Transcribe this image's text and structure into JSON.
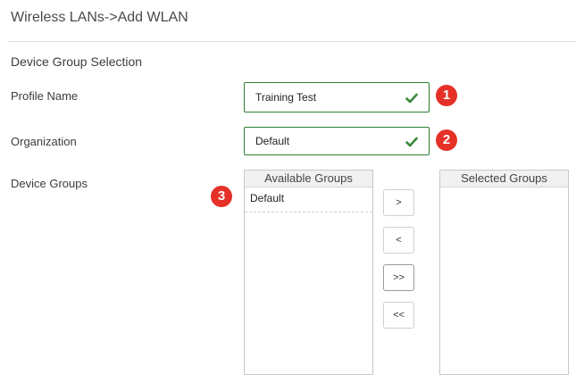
{
  "page": {
    "title": "Wireless LANs->Add WLAN"
  },
  "section": {
    "title": "Device Group Selection"
  },
  "fields": {
    "profile_name": {
      "label": "Profile Name",
      "value": "Training Test",
      "marker": "1",
      "valid_icon": "check-icon"
    },
    "organization": {
      "label": "Organization",
      "value": "Default",
      "marker": "2",
      "valid_icon": "check-icon"
    }
  },
  "device_groups": {
    "label": "Device Groups",
    "marker": "3",
    "available": {
      "header": "Available Groups",
      "items": [
        "Default"
      ]
    },
    "selected": {
      "header": "Selected Groups",
      "items": []
    },
    "buttons": {
      "add": ">",
      "remove": "<",
      "add_all": ">>",
      "remove_all": "<<"
    }
  },
  "colors": {
    "valid": "#2e7d32",
    "marker": "#e53128",
    "check": "#3a8a3a"
  }
}
